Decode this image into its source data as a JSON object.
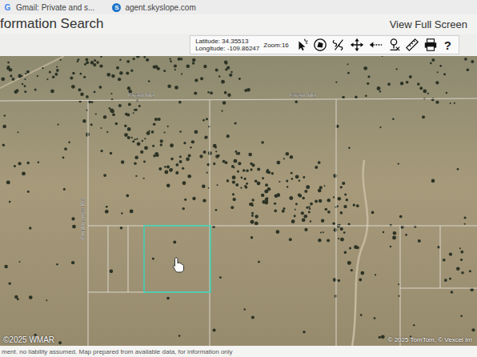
{
  "browser_tabs": [
    {
      "icon": "G",
      "label": "Gmail: Private and s..."
    },
    {
      "icon": "S",
      "label": "agent.skyslope.com"
    }
  ],
  "page": {
    "title": "formation Search",
    "full_screen_button": "View Full Screen"
  },
  "toolbar": {
    "latitude": "Latitude: 34.35513",
    "longitude": "Longitude: -109.86247",
    "zoom": "Zoom:16",
    "help": "?"
  },
  "map": {
    "roads": [
      {
        "label": "Grant Rd"
      },
      {
        "label": "Grant Rd"
      },
      {
        "label": "Bunkhouse Rd"
      }
    ],
    "selected_parcel": {
      "selected": true
    },
    "attribution": "© 2025 TomTom, © Vexcel Im",
    "watermark": "©2025 WMAR"
  },
  "disclaimer": "ment. no liability assumed. Map prepared from available data, for information only"
}
